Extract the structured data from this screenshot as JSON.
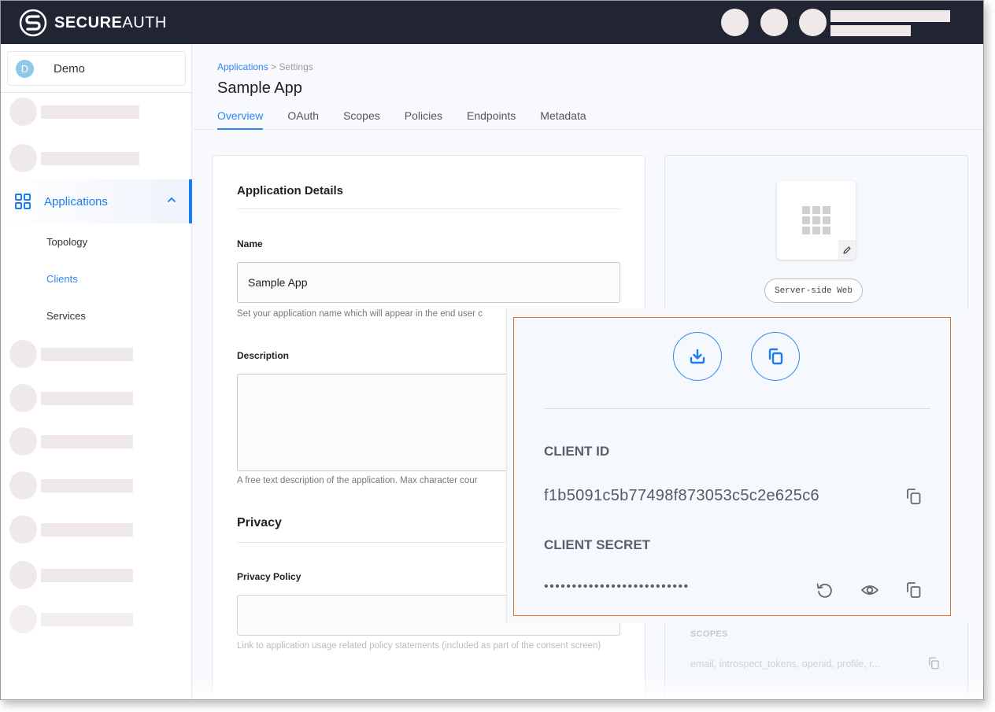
{
  "topbar": {
    "brand_bold": "SECURE",
    "brand_light": "AUTH"
  },
  "sidebar": {
    "org": {
      "initial": "D",
      "name": "Demo"
    },
    "applications": {
      "label": "Applications",
      "subitems": [
        {
          "label": "Topology",
          "active": false
        },
        {
          "label": "Clients",
          "active": true
        },
        {
          "label": "Services",
          "active": false
        }
      ]
    }
  },
  "header": {
    "breadcrumb": {
      "link": "Applications",
      "separator": " > ",
      "current": "Settings"
    },
    "title": "Sample App",
    "tabs": [
      {
        "label": "Overview",
        "active": true
      },
      {
        "label": "OAuth",
        "active": false
      },
      {
        "label": "Scopes",
        "active": false
      },
      {
        "label": "Policies",
        "active": false
      },
      {
        "label": "Endpoints",
        "active": false
      },
      {
        "label": "Metadata",
        "active": false
      }
    ]
  },
  "form": {
    "section_details": "Application Details",
    "name_label": "Name",
    "name_value": "Sample App",
    "name_help": "Set your application name which will appear in the end user c",
    "description_label": "Description",
    "description_value": "",
    "description_help": "A free text description of the application. Max character cour",
    "section_privacy": "Privacy",
    "privacy_policy_label": "Privacy Policy",
    "privacy_policy_value": "",
    "privacy_policy_help": "Link to application usage related policy statements (included as part of the consent screen)"
  },
  "app_panel": {
    "type_badge": "Server-side Web",
    "scopes_label": "SCOPES",
    "scopes_value": "email, introspect_tokens, openid, profile, r..."
  },
  "credentials": {
    "client_id_label": "CLIENT ID",
    "client_id": "f1b5091c5b77498f873053c5c2e625c6",
    "client_secret_label": "CLIENT SECRET",
    "client_secret_masked": "••••••••••••••••••••••••••"
  },
  "colors": {
    "accent": "#2f86f0",
    "topbar": "#212433",
    "highlight_border": "#e0742c"
  }
}
